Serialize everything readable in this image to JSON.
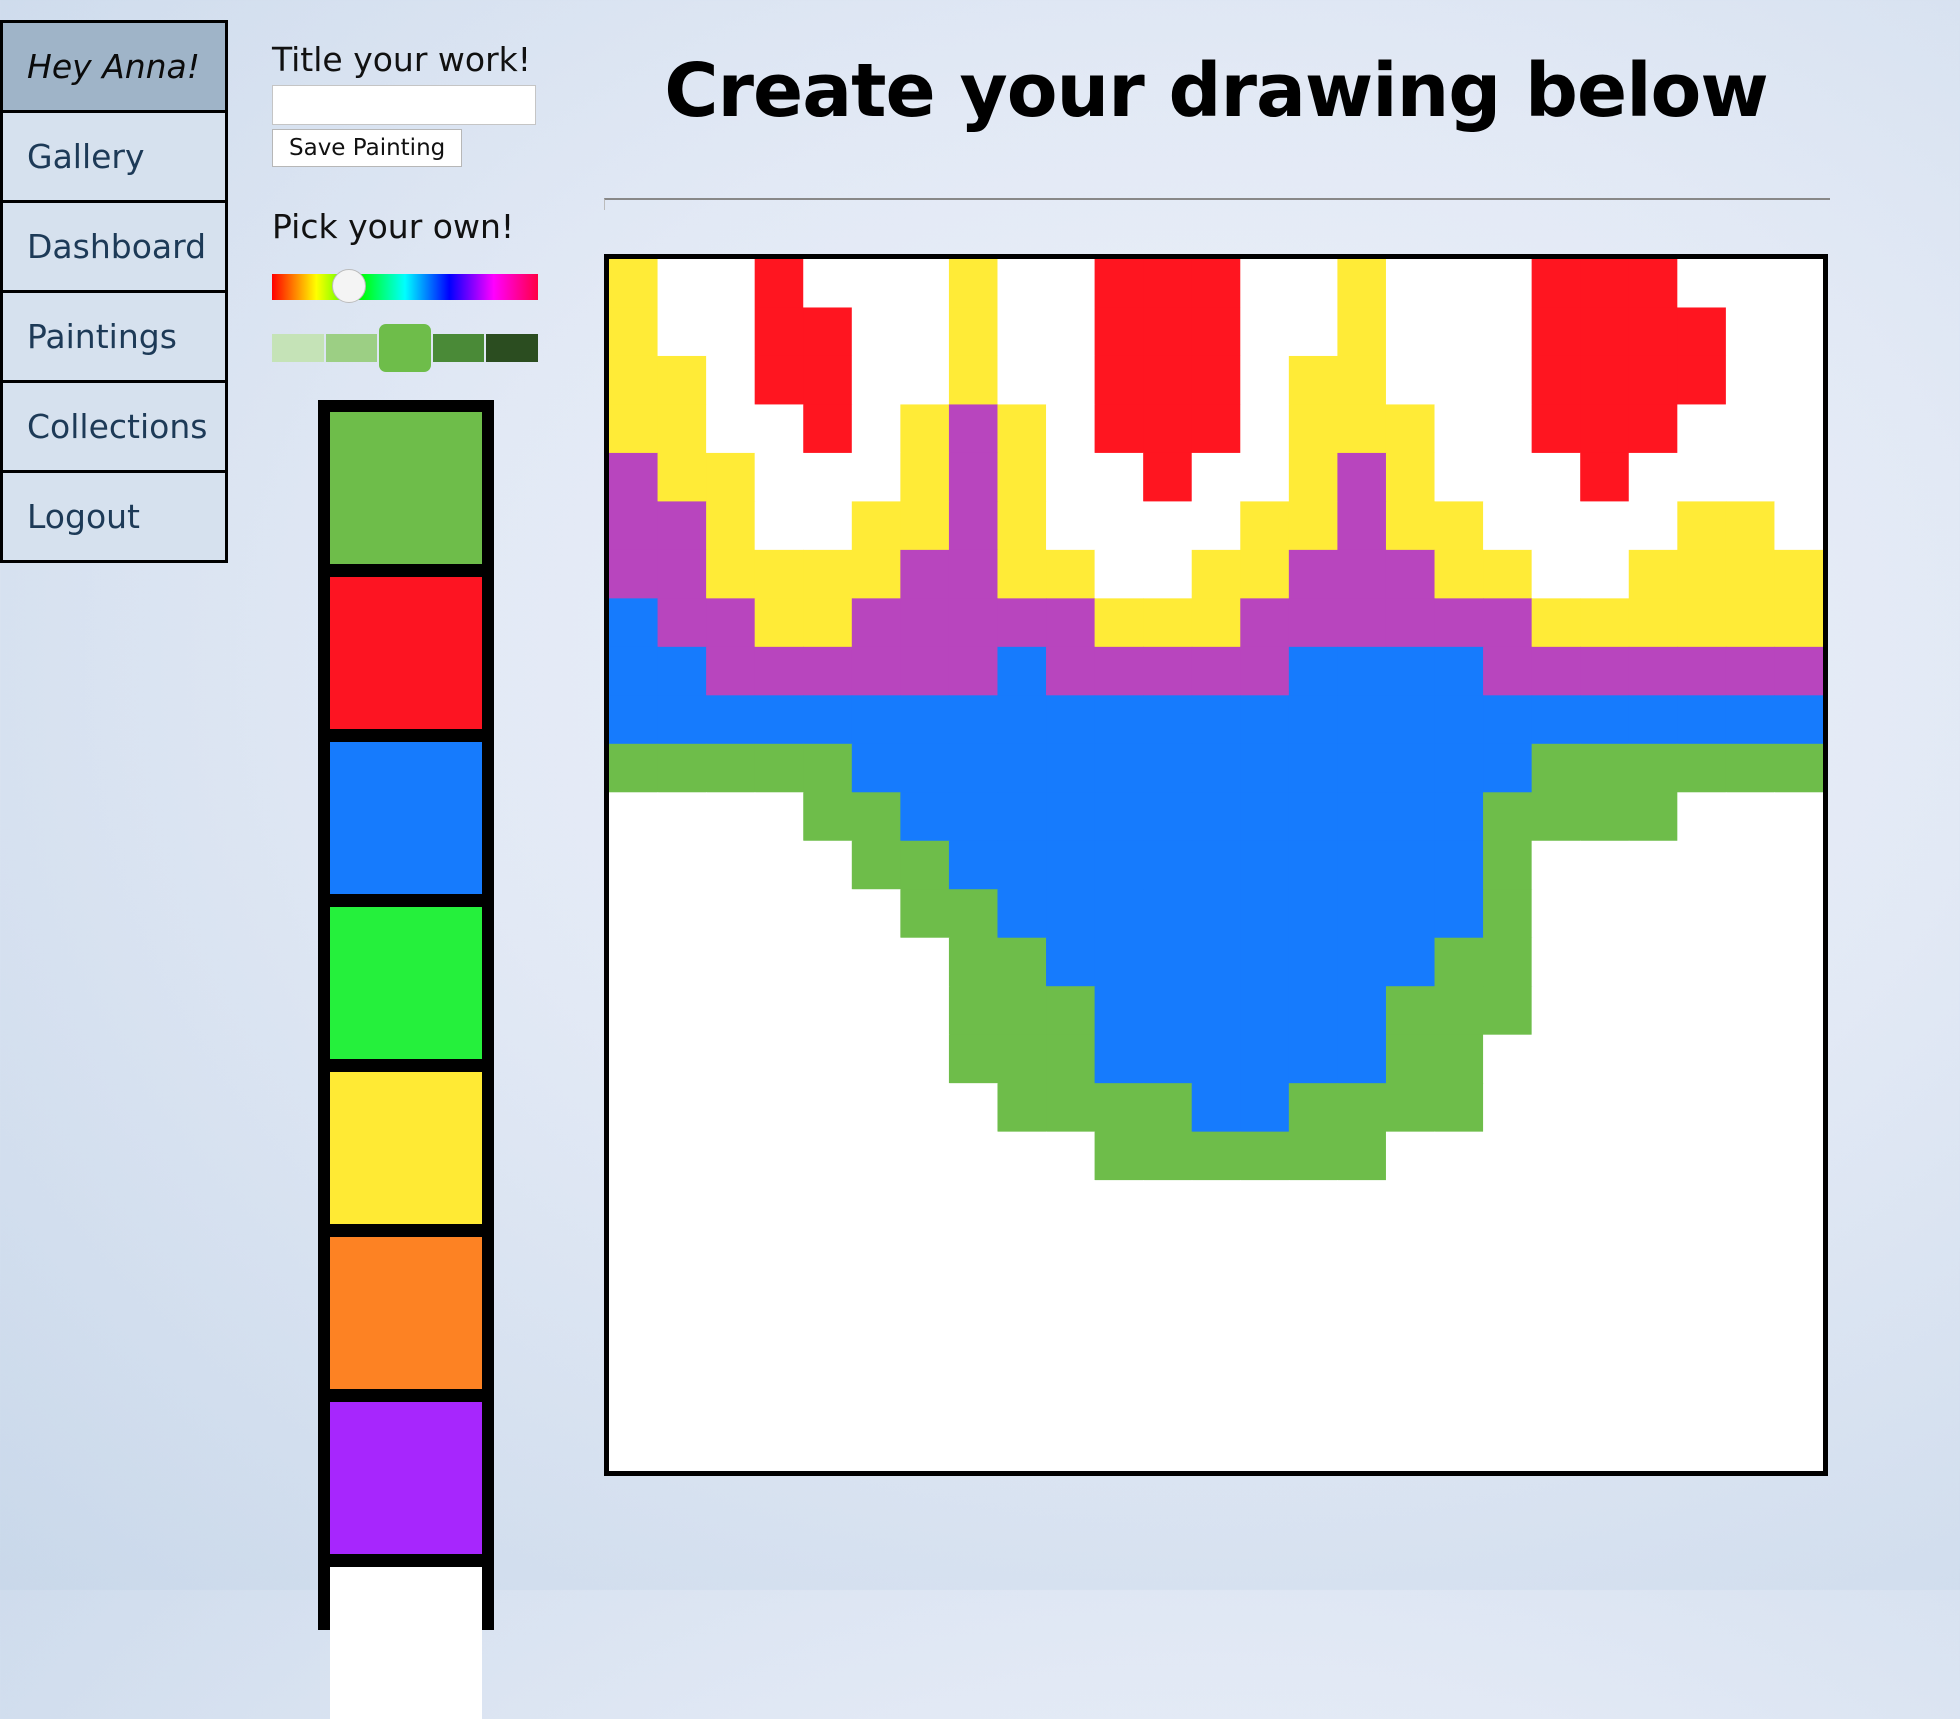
{
  "nav": {
    "items": [
      {
        "label": "Hey Anna!",
        "key": "greeting"
      },
      {
        "label": "Gallery",
        "key": "gallery"
      },
      {
        "label": "Dashboard",
        "key": "dashboard"
      },
      {
        "label": "Paintings",
        "key": "paintings"
      },
      {
        "label": "Collections",
        "key": "collections"
      },
      {
        "label": "Logout",
        "key": "logout"
      }
    ]
  },
  "controls": {
    "title_label": "Title your work!",
    "title_value": "",
    "save_label": "Save Painting",
    "pick_label": "Pick your own!",
    "shades": [
      "#c5e3b7",
      "#9ccf84",
      "#6ebd4a",
      "#4a8a37",
      "#2b4d20"
    ],
    "selected_shade": 2
  },
  "palette": {
    "colors": [
      "#6ebd4a",
      "#fd1422",
      "#167bfd",
      "#25f03c",
      "#ffea34",
      "#fd8223",
      "#a726fd",
      "#ffffff"
    ]
  },
  "heading": {
    "title": "Create your drawing below"
  },
  "drawing": {
    "grid_size": 25,
    "colors": {
      "W": "#ffffff",
      "Y": "#ffeb37",
      "R": "#ff1520",
      "P": "#b845be",
      "B": "#167bfd",
      "G": "#6ebd4a"
    },
    "rows": [
      "YWWRWWWYWWRRRWWYWWWRRRWWW",
      "YWWRRWWYWWRRRWWYWWWRRRRWW",
      "YYWRRWWYWWRRRWYYWWWRRRRWW",
      "YYWWRWYPYWRRRWYYYWWRRRWWW",
      "PYYWWWYPYWWRWWYPYWWWRWWWW",
      "PPYWWYYPYWWWWYYPYYWWWWYYW",
      "PPYYYYPPYYWWYYPPPYYWWYYYY",
      "BPPYYPPPPPYYYPPPPPPYYYYYY",
      "BBPPPPPPBPPPPPBBBBPPPPPPP",
      "BBBBBBBBBBBBBBBBBBBBBBBBB",
      "GGGGGBBBBBBBBBBBBBBGGGGGG",
      "WWWWGGBBBBBBBBBBBBGGGGWWW",
      "WWWWWGGBBBBBBBBBBBGWWWWWW",
      "WWWWWWGGBBBBBBBBBBGWWWWWW",
      "WWWWWWWGGBBBBBBBBGGWWWWWW",
      "WWWWWWWGGGBBBBBBGGGWWWWWW",
      "WWWWWWWGGGBBBBBBGGWWWWWWW",
      "WWWWWWWWGGGGBBGGGGWWWWWWW",
      "WWWWWWWWWWGGGGGGWWWWWWWWW",
      "WWWWWWWWWWWWWWWWWWWWWWWWW",
      "WWWWWWWWWWWWWWWWWWWWWWWWW",
      "WWWWWWWWWWWWWWWWWWWWWWWWW",
      "WWWWWWWWWWWWWWWWWWWWWWWWW",
      "WWWWWWWWWWWWWWWWWWWWWWWWW",
      "WWWWWWWWWWWWWWWWWWWWWWWWW"
    ]
  }
}
